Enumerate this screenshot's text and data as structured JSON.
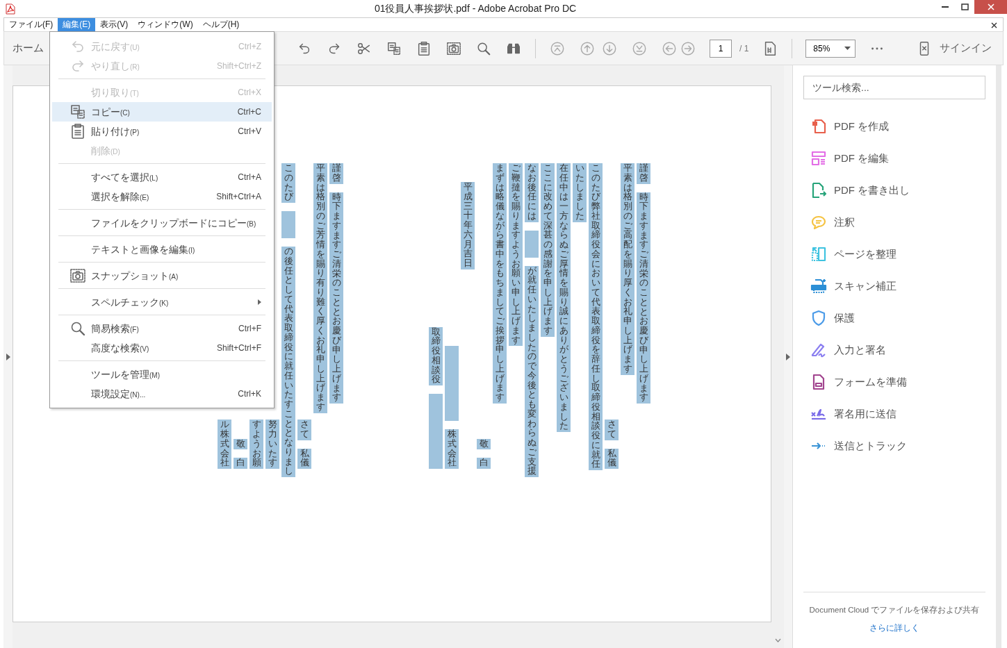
{
  "window": {
    "title": "01役員人事挨拶状.pdf - Adobe Acrobat Pro DC"
  },
  "menubar": [
    {
      "label": "ファイル(F)",
      "selected": false
    },
    {
      "label": "編集(E)",
      "selected": true
    },
    {
      "label": "表示(V)",
      "selected": false
    },
    {
      "label": "ウィンドウ(W)",
      "selected": false
    },
    {
      "label": "ヘルプ(H)",
      "selected": false
    }
  ],
  "toolbar": {
    "home_tab": "ホーム",
    "page_number": "1",
    "page_count": "/ 1",
    "zoom": "85%",
    "sign_in": "サインイン"
  },
  "edit_menu": [
    {
      "kind": "item",
      "label": "元に戻す",
      "accel": "(U)",
      "shortcut": "Ctrl+Z",
      "disabled": true,
      "selected": false
    },
    {
      "kind": "item",
      "label": "やり直し",
      "accel": "(R)",
      "shortcut": "Shift+Ctrl+Z",
      "disabled": true,
      "selected": false
    },
    {
      "kind": "separator"
    },
    {
      "kind": "item",
      "label": "切り取り",
      "accel": "(T)",
      "shortcut": "Ctrl+X",
      "disabled": true,
      "selected": false
    },
    {
      "kind": "item",
      "label": "コピー",
      "accel": "(C)",
      "shortcut": "Ctrl+C",
      "disabled": false,
      "selected": true
    },
    {
      "kind": "item",
      "label": "貼り付け",
      "accel": "(P)",
      "shortcut": "Ctrl+V",
      "disabled": false,
      "selected": false
    },
    {
      "kind": "item",
      "label": "削除",
      "accel": "(D)",
      "disabled": true,
      "selected": false
    },
    {
      "kind": "separator"
    },
    {
      "kind": "item",
      "label": "すべてを選択",
      "accel": "(L)",
      "shortcut": "Ctrl+A",
      "disabled": false,
      "selected": false
    },
    {
      "kind": "item",
      "label": "選択を解除",
      "accel": "(E)",
      "shortcut": "Shift+Ctrl+A",
      "disabled": false,
      "selected": false
    },
    {
      "kind": "separator"
    },
    {
      "kind": "item",
      "label": "ファイルをクリップボードにコピー",
      "accel": "(B)",
      "disabled": false,
      "selected": false
    },
    {
      "kind": "separator"
    },
    {
      "kind": "item",
      "label": "テキストと画像を編集",
      "accel": "(I)",
      "disabled": false,
      "selected": false
    },
    {
      "kind": "separator"
    },
    {
      "kind": "item",
      "label": "スナップショット",
      "accel": "(A)",
      "disabled": false,
      "selected": false
    },
    {
      "kind": "separator"
    },
    {
      "kind": "submenu",
      "label": "スペルチェック",
      "accel": "(K)",
      "disabled": false,
      "selected": false
    },
    {
      "kind": "separator"
    },
    {
      "kind": "item",
      "label": "簡易検索",
      "accel": "(F)",
      "shortcut": "Ctrl+F",
      "disabled": false,
      "selected": false
    },
    {
      "kind": "item",
      "label": "高度な検索",
      "accel": "(V)",
      "shortcut": "Shift+Ctrl+F",
      "disabled": false,
      "selected": false
    },
    {
      "kind": "separator"
    },
    {
      "kind": "item",
      "label": "ツールを管理",
      "accel": "(M)",
      "disabled": false,
      "selected": false
    },
    {
      "kind": "item",
      "label": "環境設定",
      "accel": "(N)...",
      "shortcut": "Ctrl+K",
      "disabled": false,
      "selected": false
    }
  ],
  "document": {
    "text_selected": true,
    "letters": [
      {
        "columns": [
          {
            "kind": "closing",
            "parts": [
              {
                "kind": "text",
                "text": "ル株式会社"
              }
            ]
          },
          {
            "kind": "closing",
            "parts": [
              {
                "kind": "text",
                "text": "敬"
              },
              {
                "kind": "text",
                "text": "白"
              }
            ]
          },
          {
            "kind": "closing",
            "parts": [
              {
                "kind": "text",
                "text": "すようお願"
              }
            ]
          },
          {
            "kind": "closing",
            "parts": [
              {
                "kind": "text",
                "text": "努力いたす"
              }
            ]
          },
          {
            "kind": "body",
            "parts": [
              {
                "kind": "text",
                "text": "このたび"
              },
              {
                "kind": "redacted_short"
              },
              {
                "kind": "text",
                "text": "の後任として代表取締役に就任いたすこととなりまし"
              }
            ]
          },
          {
            "kind": "closing",
            "parts": [
              {
                "kind": "text",
                "text": "さて"
              },
              {
                "kind": "text",
                "text": "私儀"
              }
            ]
          },
          {
            "kind": "body",
            "parts": [
              {
                "kind": "text",
                "text": "平素は格別のご芳情を賜り有り難く厚くお礼申し上げます"
              }
            ]
          },
          {
            "kind": "body",
            "parts": [
              {
                "kind": "text",
                "text": "謹啓"
              },
              {
                "kind": "text",
                "text": "時下ますますご清栄のこととお慶び申し上げます"
              }
            ]
          }
        ]
      },
      {
        "columns": [
          {
            "kind": "closing",
            "parts": [
              {
                "kind": "text",
                "text": "取締役相談役"
              },
              {
                "kind": "redacted_long"
              }
            ]
          },
          {
            "kind": "closing",
            "parts": [
              {
                "kind": "redacted_long"
              },
              {
                "kind": "text",
                "text": "株式会社"
              }
            ]
          },
          {
            "kind": "date",
            "parts": [
              {
                "kind": "text",
                "text": "平成三十年六月吉日"
              }
            ]
          },
          {
            "kind": "closing",
            "parts": [
              {
                "kind": "text",
                "text": "敬"
              },
              {
                "kind": "text",
                "text": "白"
              }
            ]
          },
          {
            "kind": "body",
            "parts": [
              {
                "kind": "text",
                "text": "まずは略儀ながら書中をもちましてご挨拶申し上げます"
              }
            ]
          },
          {
            "kind": "body",
            "parts": [
              {
                "kind": "text",
                "text": "ご鞭撻を賜りますようお願い申し上げます"
              }
            ]
          },
          {
            "kind": "body",
            "parts": [
              {
                "kind": "text",
                "text": "なお後任には"
              },
              {
                "kind": "redacted_short"
              },
              {
                "kind": "text",
                "text": "が就任いたしましたので今後とも変わらぬご支援"
              }
            ]
          },
          {
            "kind": "body",
            "parts": [
              {
                "kind": "text",
                "text": "ここに改めて深甚の感謝を申し上げます"
              }
            ]
          },
          {
            "kind": "body",
            "parts": [
              {
                "kind": "text",
                "text": "在任中は一方ならぬご厚情を賜り誠にありがとうございました"
              }
            ]
          },
          {
            "kind": "body",
            "parts": [
              {
                "kind": "text",
                "text": "いたしました"
              }
            ]
          },
          {
            "kind": "body",
            "parts": [
              {
                "kind": "text",
                "text": "このたび弊社取締役会において代表取締役を辞任し取締役相談役に就任"
              }
            ]
          },
          {
            "kind": "closing",
            "parts": [
              {
                "kind": "text",
                "text": "さて"
              },
              {
                "kind": "text",
                "text": "私儀"
              }
            ]
          },
          {
            "kind": "body",
            "parts": [
              {
                "kind": "text",
                "text": "平素は格別のご高配を賜り厚くお礼申し上げます"
              }
            ]
          },
          {
            "kind": "body",
            "parts": [
              {
                "kind": "text",
                "text": "謹啓"
              },
              {
                "kind": "text",
                "text": "時下ますますご清栄のこととお慶び申し上げます"
              }
            ]
          }
        ]
      }
    ]
  },
  "tools_panel": {
    "search": {
      "placeholder": "ツール検索..."
    },
    "tools": [
      {
        "label": "PDF を作成",
        "color": "#e8604c"
      },
      {
        "label": "PDF を編集",
        "color": "#e36ee6"
      },
      {
        "label": "PDF を書き出し",
        "color": "#27a47a"
      },
      {
        "label": "注釈",
        "color": "#f5c342"
      },
      {
        "label": "ページを整理",
        "color": "#3fc3e0"
      },
      {
        "label": "スキャン補正",
        "color": "#2c8fd6"
      },
      {
        "label": "保護",
        "color": "#4b9be8"
      },
      {
        "label": "入力と署名",
        "color": "#8b7ff0"
      },
      {
        "label": "フォームを準備",
        "color": "#a2458f"
      },
      {
        "label": "署名用に送信",
        "color": "#7a6ce8"
      },
      {
        "label": "送信とトラック",
        "color": "#3a94d6"
      }
    ],
    "footer": {
      "text": "Document Cloud でファイルを保存および共有",
      "link": "さらに詳しく"
    }
  }
}
